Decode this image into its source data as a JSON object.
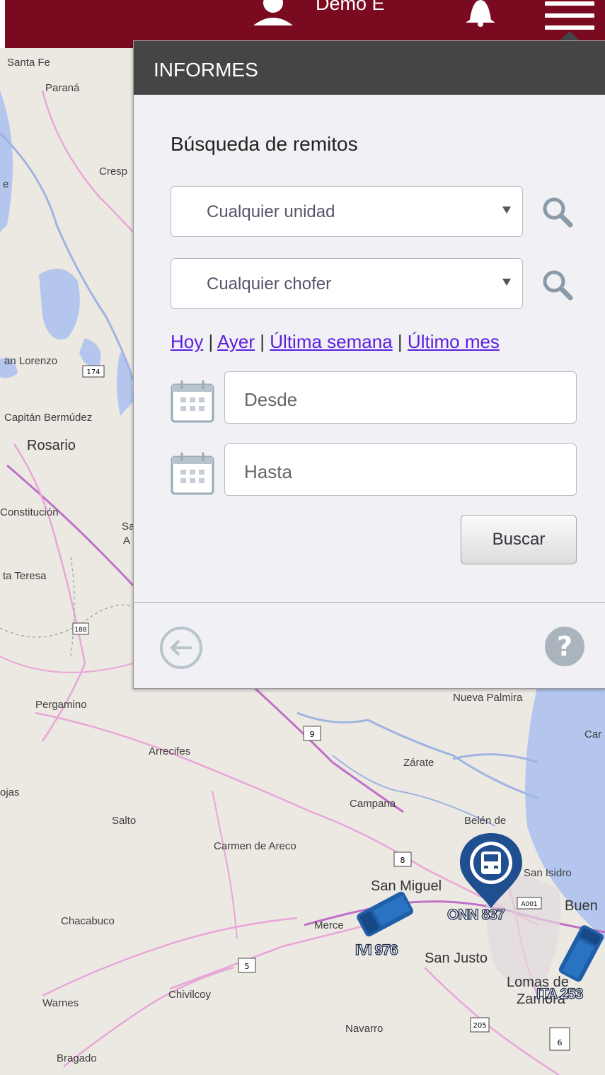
{
  "topbar": {
    "user_name": "Demo E"
  },
  "map": {
    "places": [
      {
        "name": "Santa Fe"
      },
      {
        "name": "Paraná"
      },
      {
        "name": "Cresp"
      },
      {
        "name": "e"
      },
      {
        "name": "an Lorenzo"
      },
      {
        "name": "Capitán Bermúdez"
      },
      {
        "name": "Rosario"
      },
      {
        "name": "Constitución"
      },
      {
        "name": "Sa"
      },
      {
        "name": "A"
      },
      {
        "name": "ta Teresa"
      },
      {
        "name": "Pergamino"
      },
      {
        "name": "Nueva Palmira"
      },
      {
        "name": "Car"
      },
      {
        "name": "Arrecifes"
      },
      {
        "name": "Zárate"
      },
      {
        "name": "ojas"
      },
      {
        "name": "Campana"
      },
      {
        "name": "Salto"
      },
      {
        "name": "Belén de"
      },
      {
        "name": "Carmen de Areco"
      },
      {
        "name": "San Isidro"
      },
      {
        "name": "San Miguel"
      },
      {
        "name": "Buen"
      },
      {
        "name": "Chacabuco"
      },
      {
        "name": "Merce"
      },
      {
        "name": "San Justo"
      },
      {
        "name": "Lomas de"
      },
      {
        "name": "Zamora"
      },
      {
        "name": "Chivilcoy"
      },
      {
        "name": "Warnes"
      },
      {
        "name": "Navarro"
      },
      {
        "name": "Bragado"
      }
    ],
    "route_shields": [
      "174",
      "188",
      "9",
      "8",
      "5",
      "205",
      "6",
      "A001"
    ],
    "vehicles": [
      {
        "plate": "ONN 837"
      },
      {
        "plate": "IVI 976"
      },
      {
        "plate": "ITA 253"
      }
    ]
  },
  "panel": {
    "title": "INFORMES",
    "section_title": "Búsqueda de remitos",
    "unit_select": "Cualquier unidad",
    "driver_select": "Cualquier chofer",
    "quick_links": {
      "today": "Hoy",
      "yesterday": "Ayer",
      "last_week": "Última semana",
      "last_month": "Último mes",
      "separator": "|"
    },
    "from_placeholder": "Desde",
    "to_placeholder": "Hasta",
    "search_button": "Buscar"
  },
  "colors": {
    "topbar": "#7a0a1f",
    "panel_header": "#454545",
    "link": "#5b1fe0",
    "vehicle": "#1f5fa8",
    "water": "#b4c6ee"
  }
}
